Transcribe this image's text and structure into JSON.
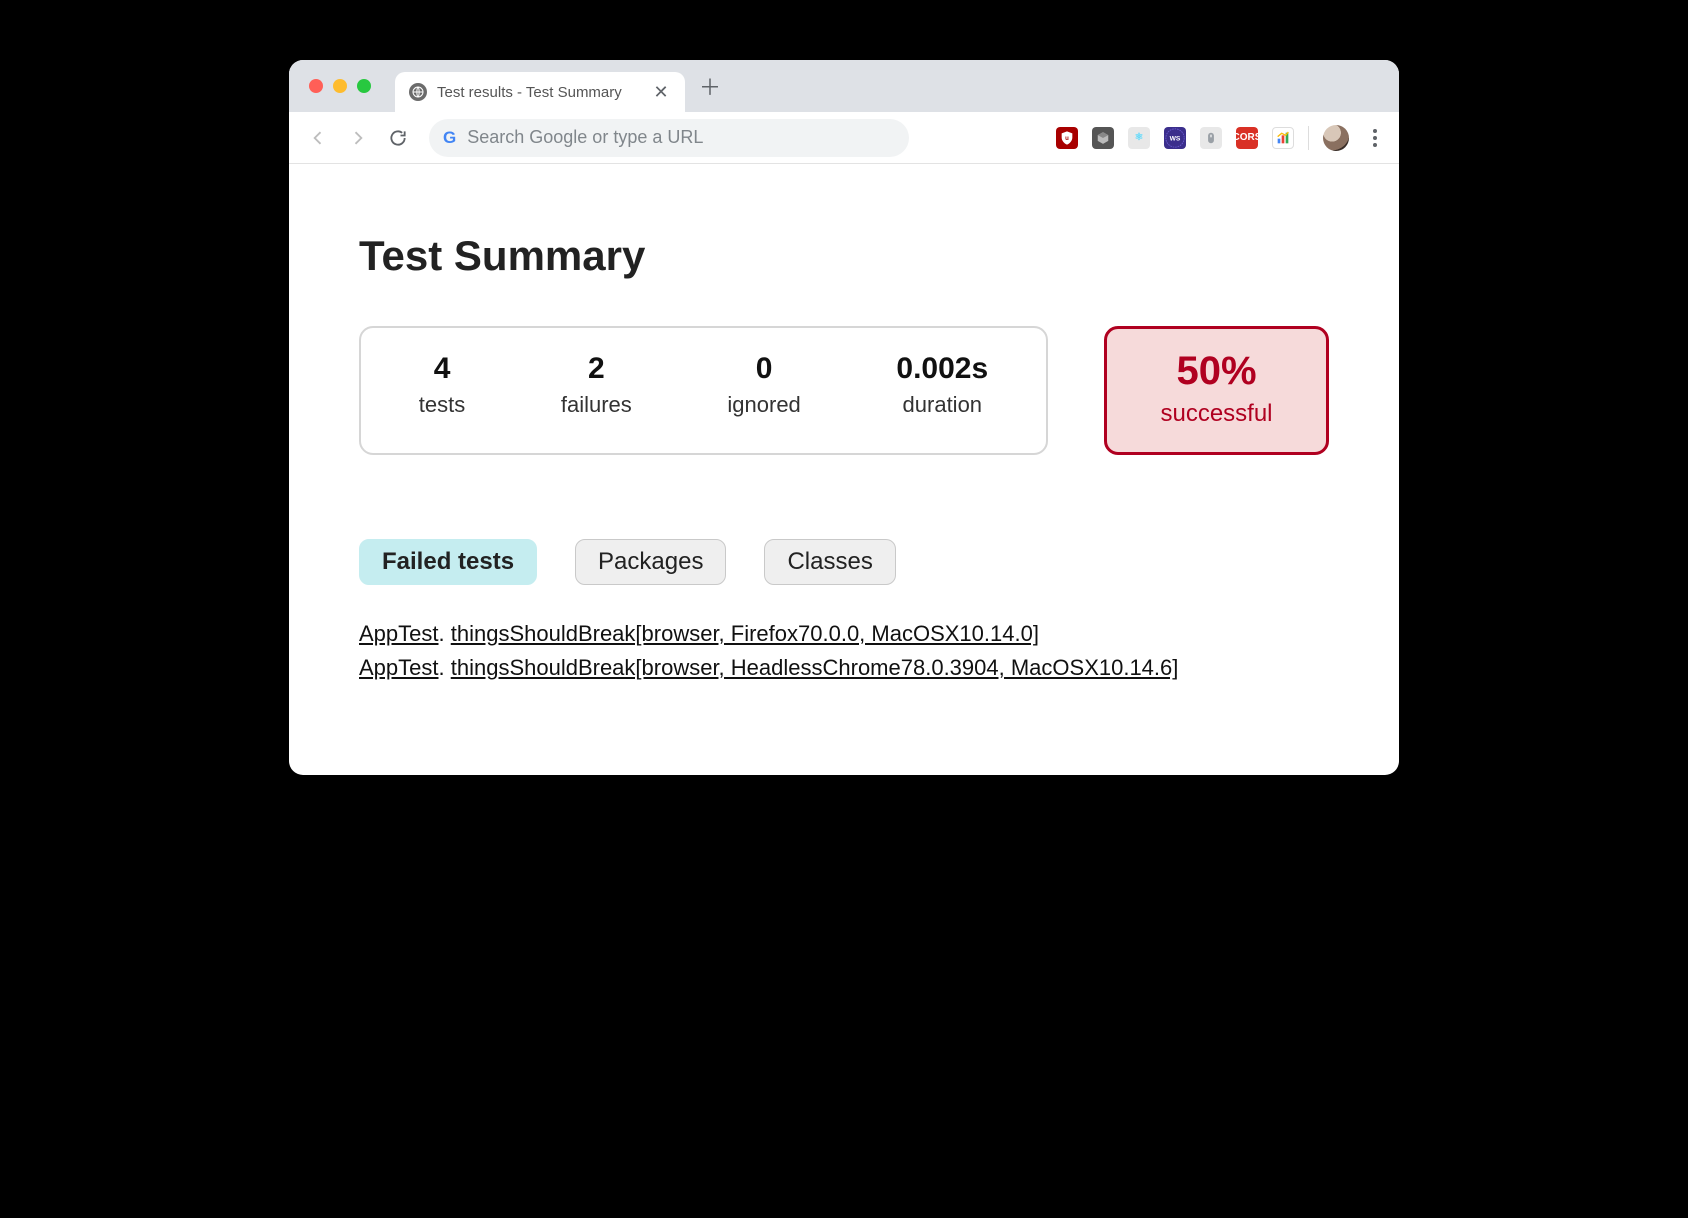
{
  "browser": {
    "tab_title": "Test results - Test Summary",
    "omnibox_placeholder": "Search Google or type a URL"
  },
  "page": {
    "title": "Test Summary",
    "stats": {
      "tests": {
        "value": "4",
        "label": "tests"
      },
      "failures": {
        "value": "2",
        "label": "failures"
      },
      "ignored": {
        "value": "0",
        "label": "ignored"
      },
      "duration": {
        "value": "0.002s",
        "label": "duration"
      }
    },
    "success": {
      "percent": "50%",
      "label": "successful"
    },
    "tabs": {
      "failed": "Failed tests",
      "packages": "Packages",
      "classes": "Classes"
    },
    "failed_tests": [
      {
        "class": "AppTest",
        "method": "thingsShouldBreak[browser, Firefox70.0.0, MacOSX10.14.0]"
      },
      {
        "class": "AppTest",
        "method": "thingsShouldBreak[browser, HeadlessChrome78.0.3904, MacOSX10.14.6]"
      }
    ]
  }
}
